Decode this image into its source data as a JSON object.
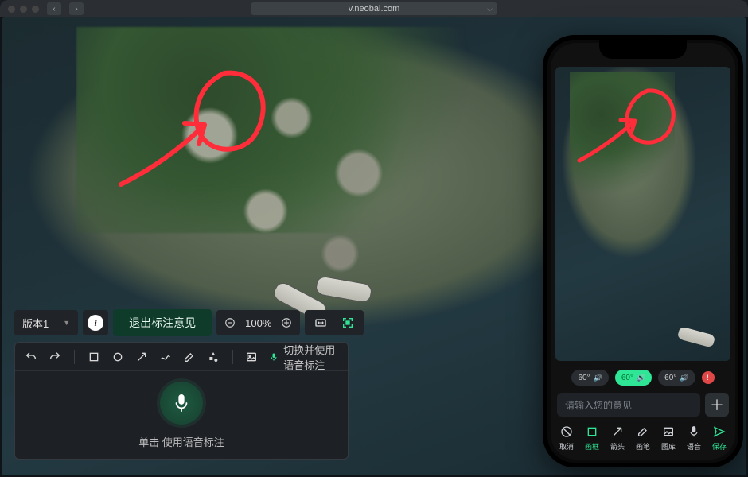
{
  "browser": {
    "url": "v.neobai.com"
  },
  "toolbar": {
    "version_label": "版本1",
    "exit_label": "退出标注意见",
    "zoom_value": "100%"
  },
  "annotation_panel": {
    "voice_toggle_label": "切换并使用语音标注",
    "hint": "单击 使用语音标注",
    "tools": {
      "undo": "undo",
      "redo": "redo",
      "crop": "crop",
      "circle": "circle",
      "arrow": "arrow",
      "freehand": "freehand",
      "brush": "brush",
      "shapes": "shapes",
      "image": "image"
    }
  },
  "mobile": {
    "chips": [
      "60°",
      "60°",
      "60°"
    ],
    "active_chip_index": 1,
    "input_placeholder": "请输入您的意见",
    "tools": [
      {
        "key": "cancel",
        "label": "取消"
      },
      {
        "key": "crop",
        "label": "画框"
      },
      {
        "key": "arrow",
        "label": "箭头"
      },
      {
        "key": "brush",
        "label": "画笔"
      },
      {
        "key": "gallery",
        "label": "图库"
      },
      {
        "key": "voice",
        "label": "语音"
      },
      {
        "key": "save",
        "label": "保存"
      }
    ]
  },
  "colors": {
    "accent": "#2ee695",
    "annotation_stroke": "#ff2d3a"
  }
}
